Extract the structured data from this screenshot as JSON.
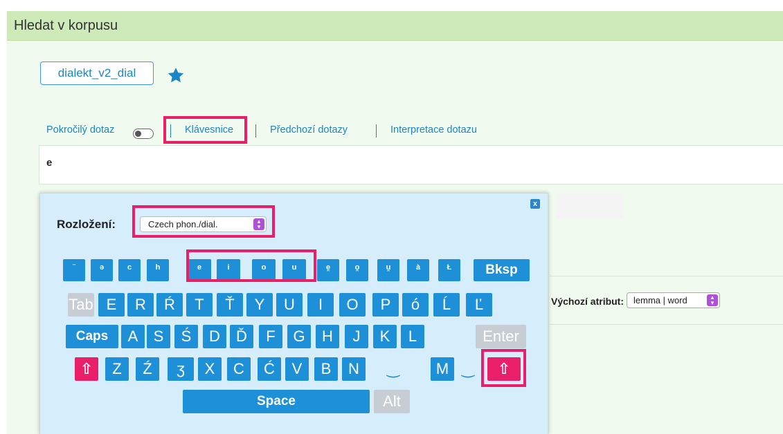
{
  "panel": {
    "title": "Hledat v korpusu"
  },
  "corpus": {
    "name": "dialekt_v2_dial"
  },
  "tabs": {
    "advanced": "Pokročilý dotaz",
    "keyboard": "Klávesnice",
    "history": "Předchozí dotazy",
    "interpretation": "Interpretace dotazu"
  },
  "query": {
    "value": "e"
  },
  "default_attr": {
    "label": "Výchozí atribut:",
    "value": "lemma | word"
  },
  "keyboard": {
    "layout_label": "Rozložení:",
    "layout_value": "Czech phon./dial.",
    "close_label": "x",
    "rows": [
      [
        "¨",
        "ə",
        "c",
        "h",
        "e",
        "i",
        "o",
        "u",
        "e̯",
        "o̯",
        "u̯",
        "à",
        "Ł",
        "Bksp"
      ],
      [
        "Tab",
        "E",
        "R",
        "Ŕ",
        "T",
        "Ť",
        "Y",
        "U",
        "I",
        "O",
        "P",
        "ó",
        "Ĺ",
        "Ľ"
      ],
      [
        "Caps",
        "A",
        "S",
        "Ś",
        "D",
        "Ď",
        "F",
        "G",
        "H",
        "J",
        "K",
        "L",
        "Enter"
      ],
      [
        "⇧",
        "Z",
        "Ź",
        "ʒ",
        "X",
        "C",
        "Ć",
        "V",
        "B",
        "N",
        "‿",
        "M",
        "‿",
        "⇧"
      ],
      [
        "Space",
        "Alt"
      ]
    ]
  },
  "colors": {
    "accent": "#1e90d8",
    "highlight": "#ea1f69",
    "header_bg": "#cdeab8",
    "keyboard_bg": "#d6eefb"
  }
}
